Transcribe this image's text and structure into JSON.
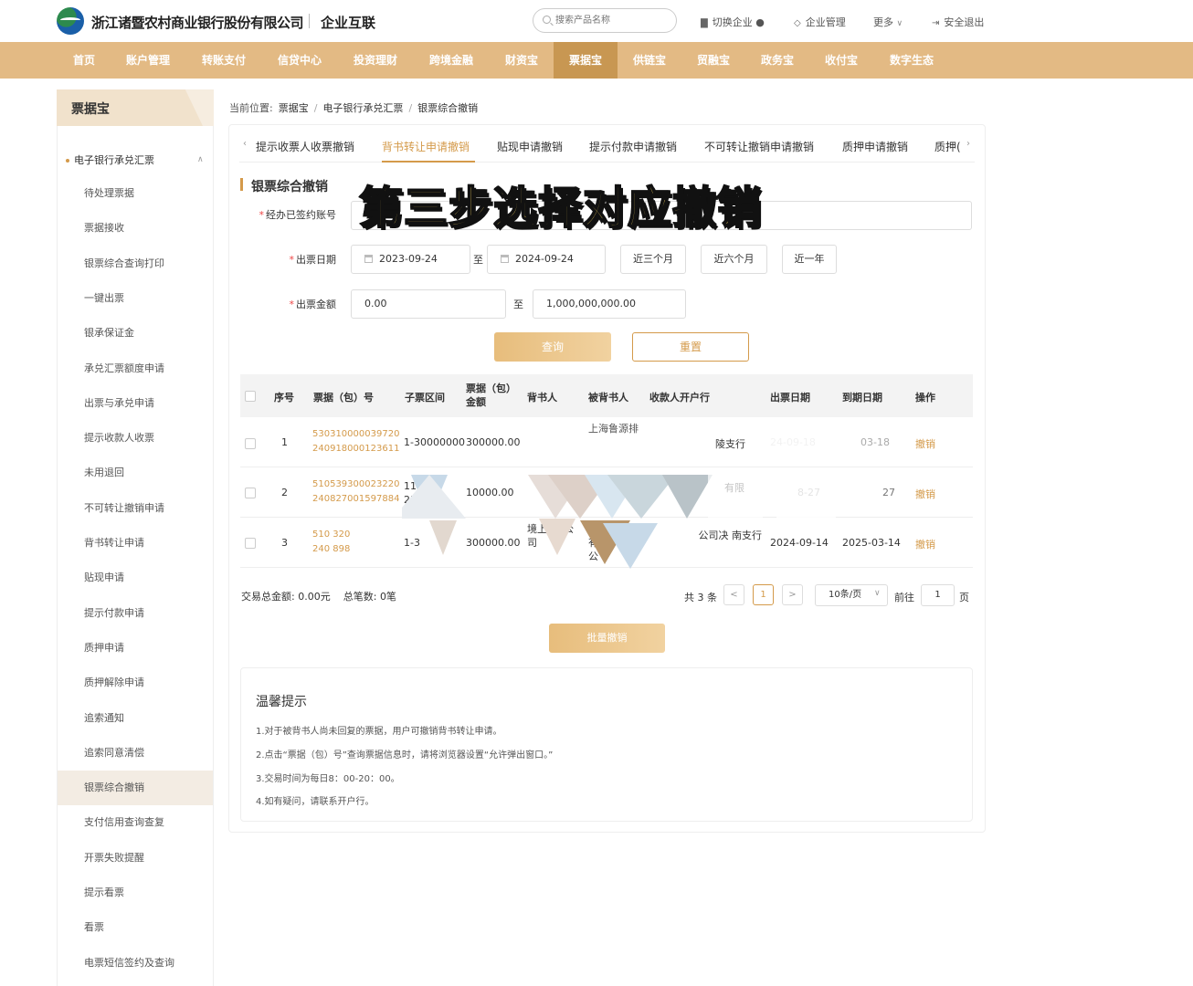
{
  "header": {
    "bank_name": "浙江诸暨农村商业银行股份有限公司",
    "system_name": "企业互联",
    "search_placeholder": "搜索产品名称",
    "switch_company": "切换企业",
    "company_manage": "企业管理",
    "more": "更多",
    "logout": "安全退出"
  },
  "nav": [
    "首页",
    "账户管理",
    "转账支付",
    "信贷中心",
    "投资理财",
    "跨境金融",
    "财资宝",
    "票据宝",
    "供链宝",
    "贸融宝",
    "政务宝",
    "收付宝",
    "数字生态"
  ],
  "nav_active": "票据宝",
  "sidebar": {
    "title": "票据宝",
    "group": "电子银行承兑汇票",
    "items": [
      "待处理票据",
      "票据接收",
      "银票综合查询打印",
      "一键出票",
      "银承保证金",
      "承兑汇票额度申请",
      "出票与承兑申请",
      "提示收款人收票",
      "未用退回",
      "不可转让撤销申请",
      "背书转让申请",
      "贴现申请",
      "提示付款申请",
      "质押申请",
      "质押解除申请",
      "追索通知",
      "追索同意清偿",
      "银票综合撤销",
      "支付信用查询查复",
      "开票失败提醒",
      "提示看票",
      "看票",
      "电票短信签约及查询"
    ],
    "active_item": "银票综合撤销"
  },
  "breadcrumb": {
    "prefix": "当前位置:",
    "path": [
      "票据宝",
      "电子银行承兑汇票",
      "银票综合撤销"
    ],
    "sep": "/"
  },
  "tabs": [
    "提示收票人收票撤销",
    "背书转让申请撤销",
    "贴现申请撤销",
    "提示付款申请撤销",
    "不可转让撤销申请撤销",
    "质押申请撤销",
    "质押("
  ],
  "tab_active": "背书转让申请撤销",
  "section_title": "银票综合撤销",
  "form": {
    "account_label": "经办已签约账号",
    "account_value": "",
    "date_label": "出票日期",
    "date_from": "2023-09-24",
    "date_to": "2024-09-24",
    "to": "至",
    "quick_ranges": [
      "近三个月",
      "近六个月",
      "近一年"
    ],
    "amount_label": "出票金额",
    "amount_from": "0.00",
    "amount_to": "1,000,000,000.00",
    "query_btn": "查询",
    "reset_btn": "重置"
  },
  "table": {
    "headers": [
      "序号",
      "票据（包）号",
      "子票区间",
      "票据（包）金额",
      "背书人",
      "被背书人",
      "收款人开户行",
      "出票日期",
      "到期日期",
      "操作"
    ],
    "rows": [
      {
        "no": "1",
        "bill_no_1": "530310000039720",
        "bill_no_2": "240918000123611",
        "range": "1-30000000",
        "amount": "300000.00",
        "endorser": "",
        "endorsee": "上海鲁源排",
        "bank": "陵支行",
        "issue_date": "24-09-18",
        "due_date": "03-18",
        "op": "撤销"
      },
      {
        "no": "2",
        "bill_no_1": "510539300023220",
        "bill_no_2": "240827001597884",
        "range": "11 25",
        "amount": "10000.00",
        "endorser": "",
        "endorsee": "",
        "bank": "有限",
        "issue_date": "8-27",
        "due_date": "27",
        "op": "撤销"
      },
      {
        "no": "3",
        "bill_no_1": "510 320",
        "bill_no_2": "240 898",
        "range": "1-3",
        "amount": "300000.00",
        "endorser": "境上 限 公司",
        "endorsee": "上 有 公",
        "bank": "公司决 南支行",
        "issue_date": "2024-09-14",
        "due_date": "2025-03-14",
        "op": "撤销"
      }
    ]
  },
  "summary": {
    "total_amount_label": "交易总金额:",
    "total_amount": "0.00元",
    "total_count_label": "总笔数:",
    "total_count": "0笔"
  },
  "pager": {
    "total": "共 3 条",
    "prev": "<",
    "current": "1",
    "next": ">",
    "page_size": "10条/页",
    "goto_label": "前往",
    "goto_value": "1",
    "unit": "页"
  },
  "batch_btn": "批量撤销",
  "tips": {
    "title": "温馨提示",
    "lines": [
      "1.对于被背书人尚未回复的票据，用户可撤销背书转让申请。",
      "2.点击“票据（包）号”查询票据信息时，请将浏览器设置“允许弹出窗口。”",
      "3.交易时间为每日8：00-20：00。",
      "4.如有疑问，请联系开户行。"
    ]
  },
  "overlay_caption": "第三步选择对应撤销",
  "colors": {
    "nav_bg": "#e3ba84",
    "nav_active": "#c89752",
    "accent": "#d49a4a"
  }
}
